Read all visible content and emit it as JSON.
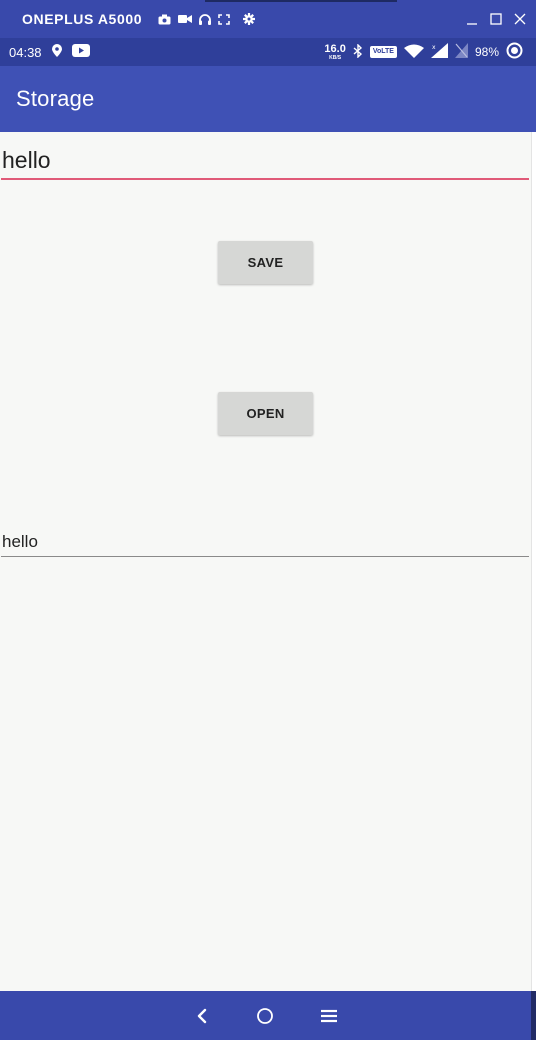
{
  "window": {
    "title": "ONEPLUS A5000",
    "toolbar_icons": [
      "camera-icon",
      "video-icon",
      "headphones-icon",
      "fullscreen-icon",
      "settings-icon"
    ],
    "controls": [
      "minimize-icon",
      "maximize-icon",
      "close-icon"
    ]
  },
  "status_bar": {
    "time": "04:38",
    "left_icons": [
      "location-pin-icon",
      "youtube-icon"
    ],
    "net_speed_value": "16.0",
    "net_speed_unit": "KB/S",
    "volte_label": "VoLTE",
    "right_icons": [
      "bluetooth-icon",
      "wifi-icon",
      "signal-icon",
      "no-sim-icon",
      "battery-ring-icon"
    ],
    "battery": "98%"
  },
  "app_bar": {
    "title": "Storage"
  },
  "main": {
    "input_value": "hello",
    "save_label": "SAVE",
    "open_label": "OPEN",
    "output_value": "hello"
  },
  "nav_bar": {
    "buttons": [
      "back-icon",
      "home-icon",
      "menu-icon"
    ]
  },
  "colors": {
    "app_bar": "#3f51b5",
    "status_bar": "#2f3f9a",
    "window_bar": "#3949ab",
    "accent_underline": "#e05a78",
    "background": "#f7f8f6",
    "button": "#d6d7d5"
  }
}
